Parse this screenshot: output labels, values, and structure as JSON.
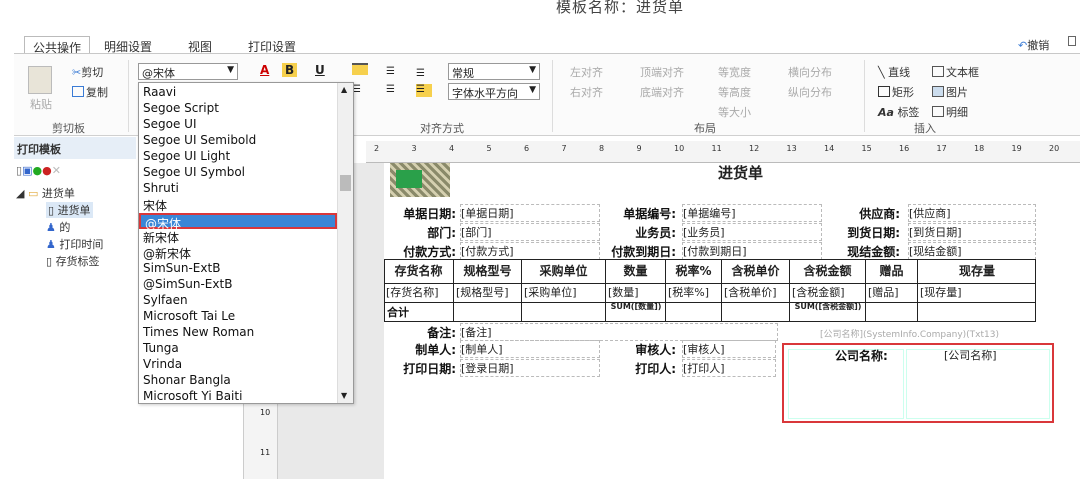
{
  "window": {
    "title": "模板名称：进货单"
  },
  "tabs": [
    "公共操作",
    "明细设置",
    "视图",
    "打印设置"
  ],
  "undo": "撤销",
  "clipboard": {
    "paste": "粘贴",
    "cut": "剪切",
    "copy": "复制",
    "group_label": "剪切板"
  },
  "font": {
    "current": "@宋体",
    "bold": "B",
    "italic": "B",
    "underline": "U",
    "color_a": "A"
  },
  "dropdown": {
    "items": [
      "Raavi",
      "Segoe Script",
      "Segoe UI",
      "Segoe UI Semibold",
      "Segoe UI Light",
      "Segoe UI Symbol",
      "Shruti",
      "宋体",
      "@宋体",
      "新宋体",
      "@新宋体",
      "SimSun-ExtB",
      "@SimSun-ExtB",
      "Sylfaen",
      "Microsoft Tai Le",
      "Times New Roman",
      "Tunga",
      "Vrinda",
      "Shonar Bangla",
      "Microsoft Yi Baiti"
    ],
    "selected_index": 8
  },
  "align": {
    "style": "常规",
    "horizontal": "字体水平方向",
    "group_label": "对齐方式"
  },
  "layout": {
    "left": "左对齐",
    "right": "右对齐",
    "top": "顶端对齐",
    "bottom": "底端对齐",
    "same_width": "等宽度",
    "same_height": "等高度",
    "same_size": "等大小",
    "h_dist": "横向分布",
    "v_dist": "纵向分布",
    "group_label": "布局"
  },
  "insert": {
    "line": "直线",
    "textbox": "文本框",
    "rect": "矩形",
    "image": "图片",
    "tag": "标签",
    "detail": "明细",
    "group_label": "插入"
  },
  "left_panel": {
    "title": "打印模板",
    "tree": [
      "进货单",
      "进货单",
      "的",
      "打印时间",
      "存货标签"
    ]
  },
  "ruler": {
    "marks": [
      "2",
      "3",
      "4",
      "5",
      "6",
      "7",
      "8",
      "9",
      "10",
      "11",
      "12",
      "13",
      "14",
      "15",
      "16",
      "17",
      "18",
      "19",
      "20"
    ],
    "vmarks": [
      "10",
      "11"
    ]
  },
  "doc": {
    "title": "进货单",
    "rows": [
      [
        [
          "单据日期:",
          "[单据日期]"
        ],
        [
          "单据编号:",
          "[单据编号]"
        ],
        [
          "供应商:",
          "[供应商]"
        ]
      ],
      [
        [
          "部门:",
          "[部门]"
        ],
        [
          "业务员:",
          "[业务员]"
        ],
        [
          "到货日期:",
          "[到货日期]"
        ]
      ],
      [
        [
          "付款方式:",
          "[付款方式]"
        ],
        [
          "付款到期日:",
          "[付款到期日]"
        ],
        [
          "现结金额:",
          "[现结金额]"
        ]
      ]
    ],
    "table_headers": [
      "存货名称",
      "规格型号",
      "采购单位",
      "数量",
      "税率%",
      "含税单价",
      "含税金额",
      "赠品",
      "现存量"
    ],
    "table_fields": [
      "[存货名称]",
      "[规格型号]",
      "[采购单位]",
      "[数量]",
      "[税率%]",
      "[含税单价]",
      "[含税金额]",
      "[赠品]",
      "[现存量]"
    ],
    "total_label": "合计",
    "sum_qty": "SUM([数量])",
    "sum_amt": "SUM([含税金额])",
    "remark": [
      "备注:",
      "[备注]"
    ],
    "footer": [
      [
        [
          "制单人:",
          "[制单人]"
        ],
        [
          "审核人:",
          "[审核人]"
        ]
      ],
      [
        [
          "打印日期:",
          "[登录日期]"
        ],
        [
          "打印人:",
          "[打印人]"
        ]
      ]
    ],
    "company_hint": "[公司名称](SystemInfo.Company)(Txt13)",
    "company_label": "公司名称:",
    "company_field": "[公司名称]"
  }
}
